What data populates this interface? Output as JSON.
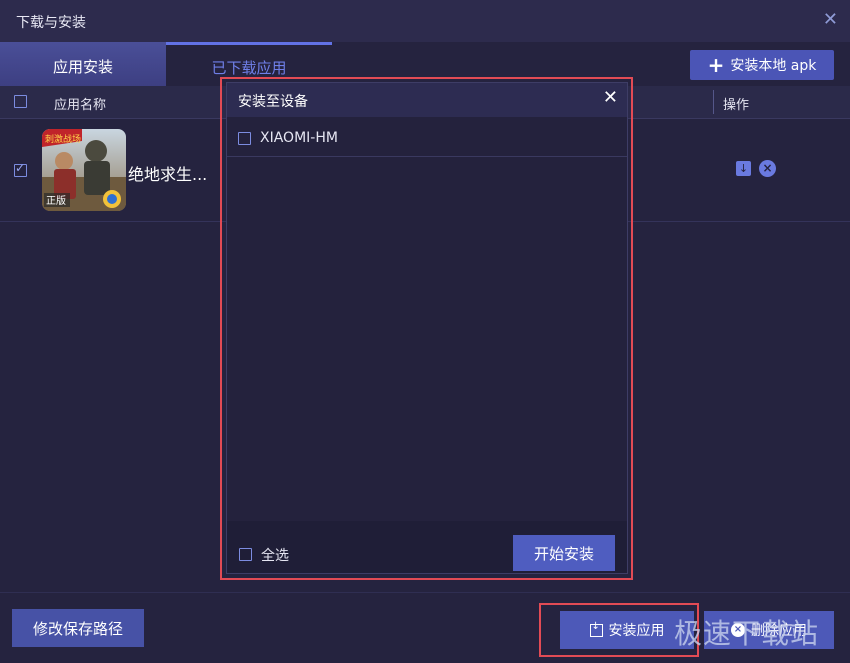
{
  "window": {
    "title": "下载与安装",
    "close_icon": "close-icon"
  },
  "tabs": [
    {
      "label": "应用安装",
      "active": false
    },
    {
      "label": "已下载应用",
      "active": true
    }
  ],
  "toolbar": {
    "install_local_apk": "安装本地 apk",
    "plus_glyph": "+"
  },
  "table": {
    "headers": {
      "name": "应用名称",
      "op": "操作"
    },
    "rows": [
      {
        "checked": true,
        "name": "绝地求生...",
        "icon_text": [
          "刺激战场",
          "正版"
        ]
      }
    ]
  },
  "dialog": {
    "title": "安装至设备",
    "devices": [
      {
        "name": "XIAOMI-HM",
        "checked": false
      }
    ],
    "select_all": "全选",
    "start_install": "开始安装"
  },
  "footer": {
    "modify_path": "修改保存路径",
    "install_app": "安装应用",
    "delete_app": "删除应用"
  },
  "watermark": "极速下载站",
  "colors": {
    "accent": "#6272e6",
    "button": "#4d59b8",
    "highlight": "#e24b55",
    "background": "#25233f"
  }
}
